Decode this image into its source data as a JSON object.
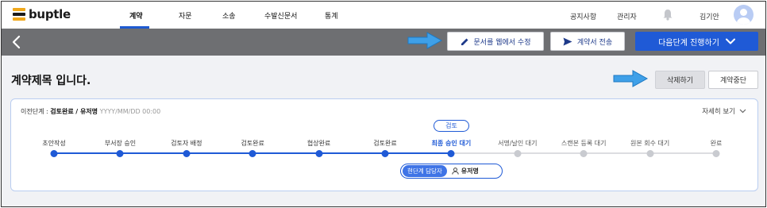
{
  "app": {
    "logo_text": "buptle"
  },
  "nav": {
    "items": [
      "계약",
      "자문",
      "소송",
      "수발신문서",
      "통계"
    ],
    "active_index": 0,
    "notice": "공지사항",
    "admin": "관리자",
    "user_name": "김기안"
  },
  "actionbar": {
    "edit_label": "문서를 웹에서 수정",
    "send_label": "계약서 전송",
    "next_label": "다음단계 진행하기"
  },
  "page": {
    "title": "계약제목 입니다.",
    "delete_label": "삭제하기",
    "stop_label": "계약중단"
  },
  "progress": {
    "prev_prefix": "이전단계 : ",
    "prev_step": "검토완료",
    "prev_user": "/ 유저명",
    "prev_time": "YYYY/MM/DD 00:00",
    "detail_label": "자세히 보기",
    "status_badge": "검토",
    "steps": [
      "초안작성",
      "부서장 승인",
      "검토자 배정",
      "검토완료",
      "협상완료",
      "검토완료",
      "최종 승인 대기",
      "서명/날인 대기",
      "스캔본 등록 대기",
      "원본 회수 대기",
      "완료"
    ],
    "current_index": 6,
    "assignee_tag": "현단계 담당자",
    "assignee_name": "유저명"
  },
  "colors": {
    "accent": "#1f5ad6",
    "action_bar": "#6e6f72",
    "pending_dot": "#c9cbd0",
    "logo_yellow": "#f0a81c",
    "pointer_arrow": "#3fa0e8"
  }
}
